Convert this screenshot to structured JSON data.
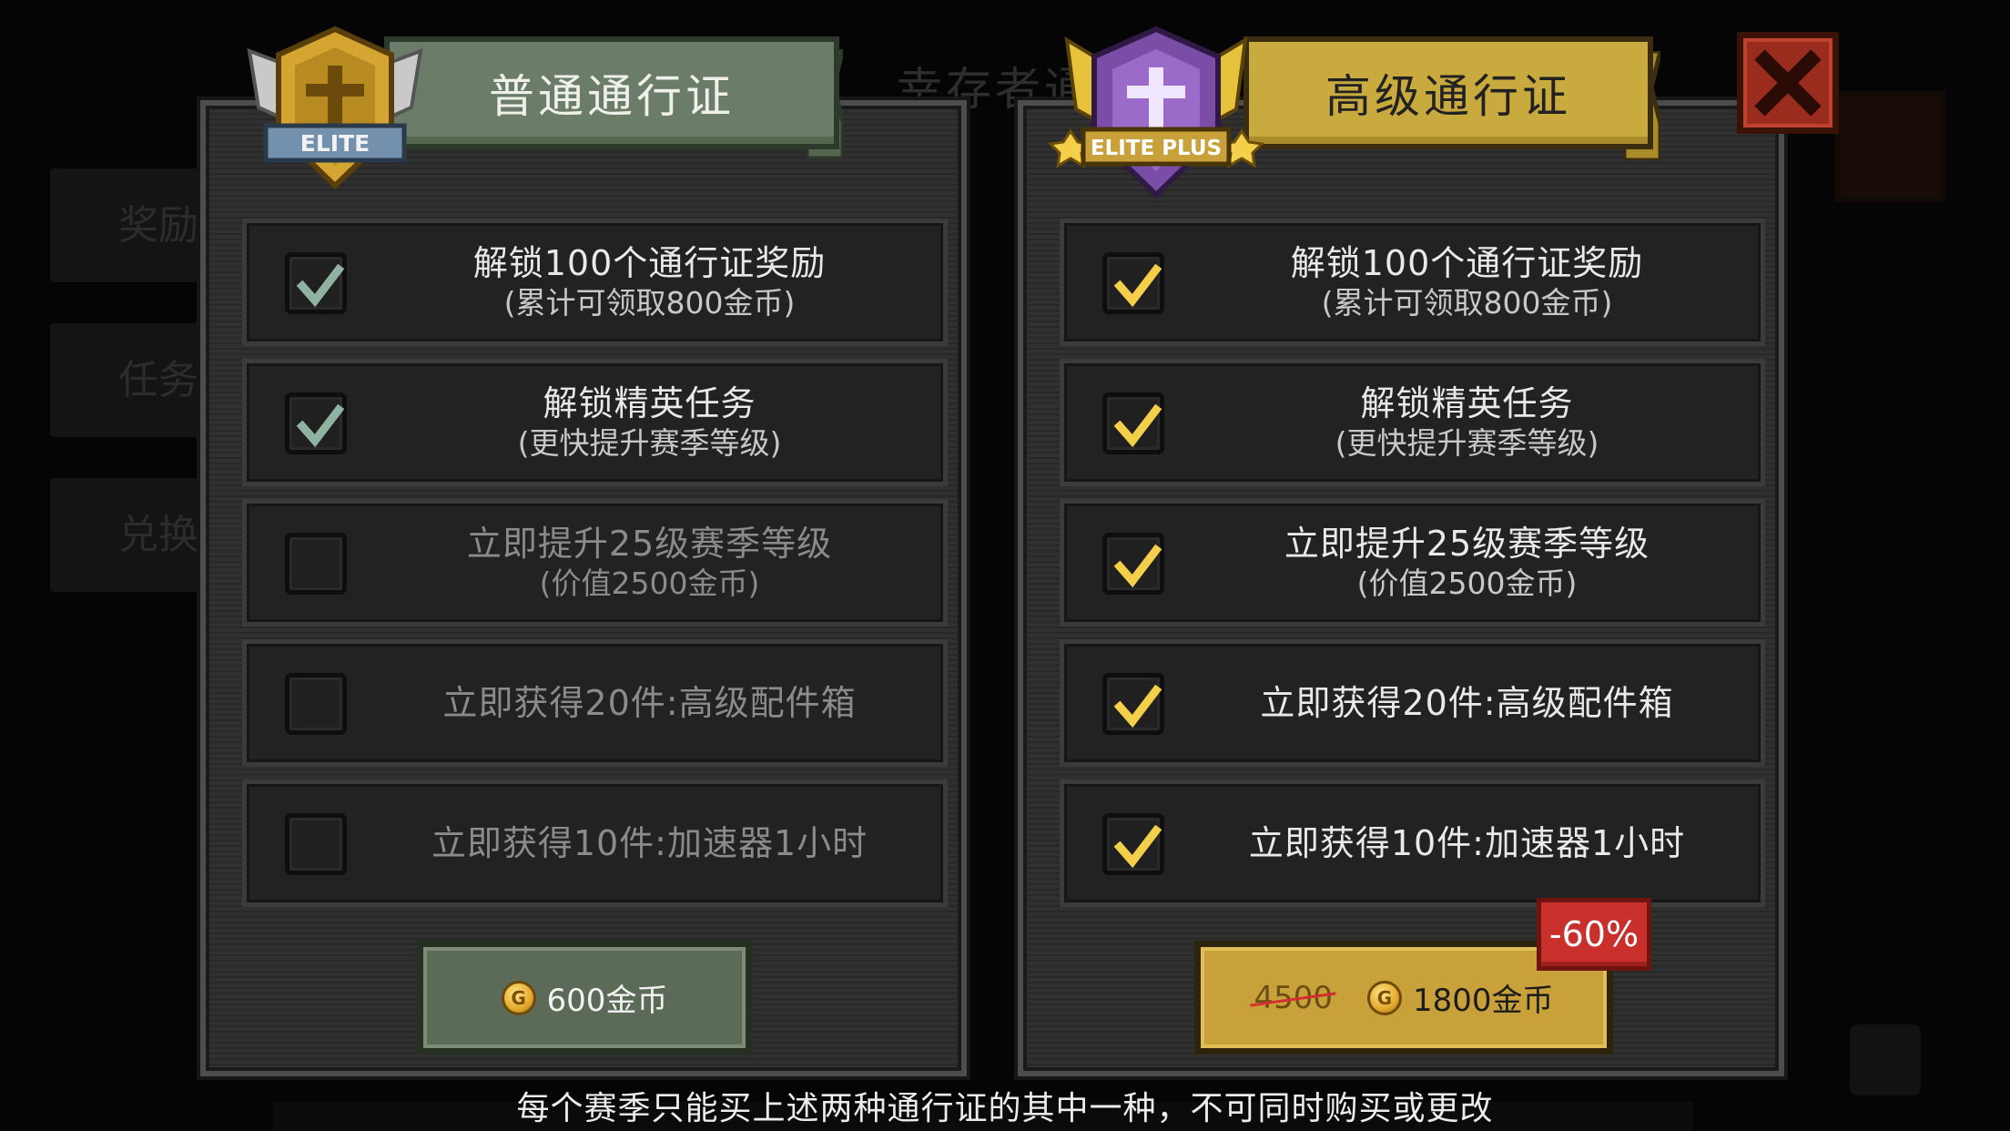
{
  "background": {
    "tabs": [
      "奖励",
      "任务",
      "兑换"
    ],
    "title": "幸存者通"
  },
  "normal_pass": {
    "title": "普通通行证",
    "badge_text": "ELITE",
    "rows": [
      {
        "main": "解锁100个通行证奖励",
        "sub": "(累计可领取800金币)",
        "checked": true
      },
      {
        "main": "解锁精英任务",
        "sub": "(更快提升赛季等级)",
        "checked": true
      },
      {
        "main": "立即提升25级赛季等级",
        "sub": "(价值2500金币)",
        "checked": false
      },
      {
        "main": "立即获得20件:高级配件箱",
        "sub": "",
        "checked": false
      },
      {
        "main": "立即获得10件:加速器1小时",
        "sub": "",
        "checked": false
      }
    ],
    "price": "600金币"
  },
  "premium_pass": {
    "title": "高级通行证",
    "badge_text": "ELITE PLUS",
    "rows": [
      {
        "main": "解锁100个通行证奖励",
        "sub": "(累计可领取800金币)",
        "checked": true
      },
      {
        "main": "解锁精英任务",
        "sub": "(更快提升赛季等级)",
        "checked": true
      },
      {
        "main": "立即提升25级赛季等级",
        "sub": "(价值2500金币)",
        "checked": true
      },
      {
        "main": "立即获得20件:高级配件箱",
        "sub": "",
        "checked": true
      },
      {
        "main": "立即获得10件:加速器1小时",
        "sub": "",
        "checked": true
      }
    ],
    "original_price": "4500",
    "price": "1800金币",
    "discount": "-60%"
  },
  "footer_note": "每个赛季只能买上述两种通行证的其中一种，不可同时购买或更改",
  "colors": {
    "normal_check": "#8fb3a0",
    "premium_check": "#f4cf4a",
    "close_bg": "#9a2c1e",
    "discount_bg": "#c9302c"
  },
  "icons": {
    "close": "close-icon",
    "coin": "gold-coin-icon",
    "elite_badge": "elite-shield-badge",
    "elite_plus_badge": "elite-plus-shield-badge"
  }
}
